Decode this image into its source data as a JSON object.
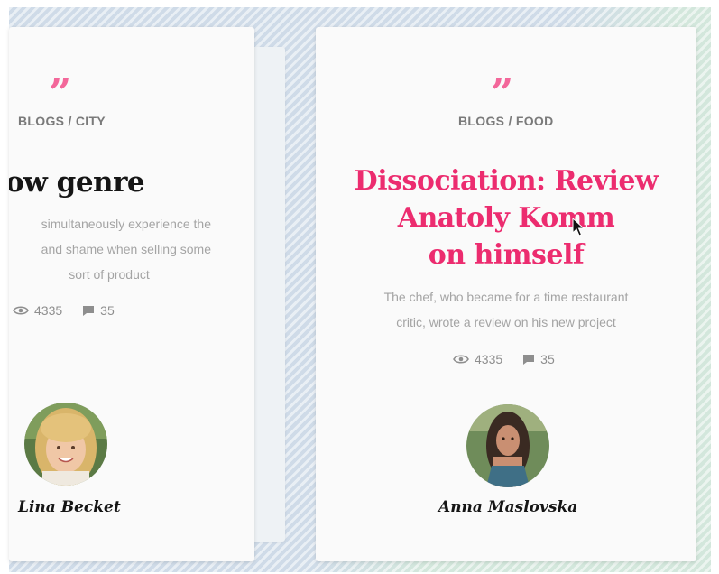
{
  "cards": [
    {
      "category": "BLOGS / CITY",
      "title": "ow genre",
      "description_lines": [
        "simultaneously experience the",
        "and shame when selling some",
        "sort of product"
      ],
      "views": "4335",
      "comments": "35",
      "author": "Lina Becket",
      "avatar_icon": "blonde-woman-portrait"
    },
    {
      "category": "BLOGS / FOOD",
      "title_lines": [
        "Dissociation: Review",
        "Anatoly Komm",
        "on himself"
      ],
      "description_lines": [
        "The chef, who became for a time  restaurant",
        "critic, wrote a review on his new project"
      ],
      "views": "4335",
      "comments": "35",
      "author": "Anna Maslovska",
      "avatar_icon": "dark-haired-woman-portrait"
    }
  ],
  "icons": {
    "quote": "quote-icon",
    "views": "eye-icon",
    "comments": "comment-icon",
    "cursor": "mouse-pointer-icon"
  },
  "colors": {
    "accent_pink": "#ec2c6f",
    "quote_pink": "#f3679a",
    "text_dark": "#151515",
    "text_gray": "#a4a4a4",
    "card_bg": "#fafafa"
  }
}
